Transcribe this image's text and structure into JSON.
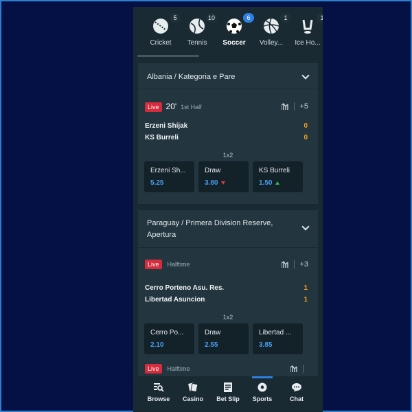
{
  "sports": [
    {
      "label": "Cricket",
      "count": "5",
      "icon": "cricket-ball-icon",
      "active": false
    },
    {
      "label": "Tennis",
      "count": "10",
      "icon": "tennis-ball-icon",
      "active": false
    },
    {
      "label": "Soccer",
      "count": "6",
      "icon": "soccer-ball-icon",
      "active": true
    },
    {
      "label": "Volley...",
      "count": "1",
      "icon": "volleyball-icon",
      "active": false
    },
    {
      "label": "Ice Ho...",
      "count": "1",
      "icon": "ice-hockey-icon",
      "active": false
    }
  ],
  "leagues": [
    {
      "title": "Albania / Kategoria e Pare",
      "match": {
        "live_label": "Live",
        "minute": "20'",
        "phase": "1st Half",
        "more": "+5",
        "home": {
          "name": "Erzeni Shijak",
          "score": "0"
        },
        "away": {
          "name": "KS Burreli",
          "score": "0"
        },
        "market": "1x2",
        "odds": [
          {
            "name": "Erzeni Sh...",
            "price": "5.25",
            "trend": "none"
          },
          {
            "name": "Draw",
            "price": "3.80",
            "trend": "down"
          },
          {
            "name": "KS Burreli",
            "price": "1.50",
            "trend": "up"
          }
        ]
      }
    },
    {
      "title": "Paraguay / Primera Division Reserve, Apertura",
      "match": {
        "live_label": "Live",
        "phase": "Halftime",
        "more": "+3",
        "home": {
          "name": "Cerro Porteno Asu. Res.",
          "score": "1"
        },
        "away": {
          "name": "Libertad Asuncion",
          "score": "1"
        },
        "market": "1x2",
        "odds": [
          {
            "name": "Cerro Po...",
            "price": "2.10",
            "trend": "none"
          },
          {
            "name": "Draw",
            "price": "2.55",
            "trend": "none"
          },
          {
            "name": "Libertad ...",
            "price": "3.85",
            "trend": "none"
          }
        ]
      }
    }
  ],
  "partial_match": {
    "live_label": "Live",
    "phase": "Halftime"
  },
  "nav": [
    {
      "label": "Browse",
      "icon": "browse-icon"
    },
    {
      "label": "Casino",
      "icon": "casino-icon"
    },
    {
      "label": "Bet Slip",
      "icon": "bet-slip-icon"
    },
    {
      "label": "Sports",
      "icon": "sports-icon"
    },
    {
      "label": "Chat",
      "icon": "chat-icon"
    }
  ],
  "colors": {
    "background": "#051144",
    "panel": "#1a2a33",
    "card": "#23363f",
    "live": "#d42c3c",
    "score": "#f4a11a",
    "price": "#4a9df0",
    "accent": "#2e7fe6"
  }
}
